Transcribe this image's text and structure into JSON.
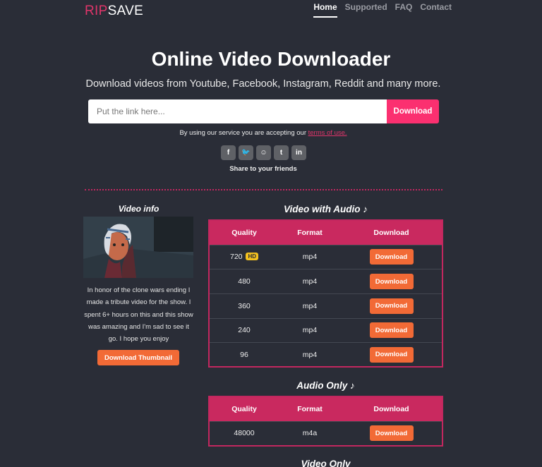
{
  "header": {
    "logo_part1": "RIP",
    "logo_part2": "SAVE",
    "nav": [
      {
        "label": "Home",
        "active": true
      },
      {
        "label": "Supported",
        "active": false
      },
      {
        "label": "FAQ",
        "active": false
      },
      {
        "label": "Contact",
        "active": false
      }
    ]
  },
  "hero": {
    "title": "Online Video Downloader",
    "subtitle": "Download videos from Youtube, Facebook, Instagram, Reddit and many more."
  },
  "search": {
    "placeholder": "Put the link here...",
    "value": "",
    "button_label": "Download"
  },
  "terms": {
    "prefix": "By using our service you are accepting our ",
    "link_label": "terms of use."
  },
  "share": {
    "icons": [
      {
        "name": "facebook-icon",
        "glyph": "f"
      },
      {
        "name": "twitter-icon",
        "glyph": "🐦"
      },
      {
        "name": "reddit-icon",
        "glyph": "☺"
      },
      {
        "name": "tumblr-icon",
        "glyph": "t"
      },
      {
        "name": "linkedin-icon",
        "glyph": "in"
      }
    ],
    "label": "Share to your friends"
  },
  "video_info": {
    "title": "Video info",
    "description": "In honor of the clone wars ending I made a tribute video for the show. I spent 6+ hours on this and this show was amazing and I'm sad to see it go. I hope you enjoy",
    "thumbnail_button": "Download Thumbnail"
  },
  "video_with_audio": {
    "title": "Video with Audio ♪",
    "columns": [
      "Quality",
      "Format",
      "Download"
    ],
    "rows": [
      {
        "quality": "720",
        "badge": "HD",
        "format": "mp4",
        "button": "Download"
      },
      {
        "quality": "480",
        "badge": "",
        "format": "mp4",
        "button": "Download"
      },
      {
        "quality": "360",
        "badge": "",
        "format": "mp4",
        "button": "Download"
      },
      {
        "quality": "240",
        "badge": "",
        "format": "mp4",
        "button": "Download"
      },
      {
        "quality": "96",
        "badge": "",
        "format": "mp4",
        "button": "Download"
      }
    ]
  },
  "audio_only": {
    "title": "Audio Only ♪",
    "columns": [
      "Quality",
      "Format",
      "Download"
    ],
    "rows": [
      {
        "quality": "48000",
        "badge": "",
        "format": "m4a",
        "button": "Download"
      }
    ]
  },
  "video_only": {
    "title": "Video Only"
  }
}
